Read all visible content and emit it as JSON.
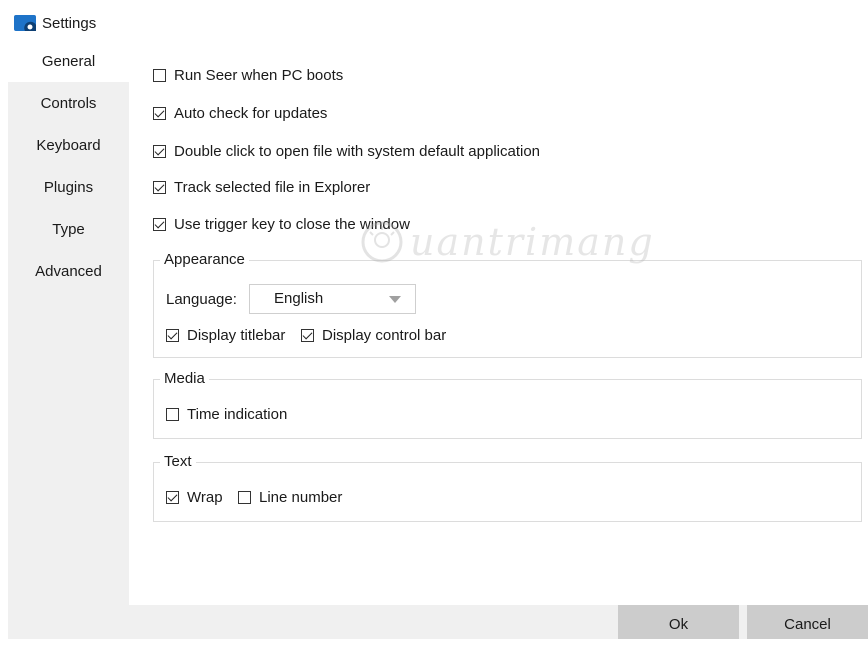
{
  "window": {
    "title": "Settings",
    "icon": "app-icon"
  },
  "sidebar": {
    "items": [
      {
        "label": "General",
        "selected": true
      },
      {
        "label": "Controls"
      },
      {
        "label": "Keyboard"
      },
      {
        "label": "Plugins"
      },
      {
        "label": "Type"
      },
      {
        "label": "Advanced"
      }
    ]
  },
  "general": {
    "options": [
      {
        "label": "Run Seer when PC boots",
        "checked": false
      },
      {
        "label": "Auto check for updates",
        "checked": true
      },
      {
        "label": "Double click to open file with system default application",
        "checked": true
      },
      {
        "label": "Track selected file in Explorer",
        "checked": true
      },
      {
        "label": "Use trigger key to close the window",
        "checked": true
      }
    ]
  },
  "appearance": {
    "title": "Appearance",
    "language_label": "Language:",
    "language_value": "English",
    "display_titlebar": {
      "label": "Display titlebar",
      "checked": true
    },
    "display_control_bar": {
      "label": "Display control bar",
      "checked": true
    }
  },
  "media": {
    "title": "Media",
    "time_indication": {
      "label": "Time indication",
      "checked": false
    }
  },
  "text": {
    "title": "Text",
    "wrap": {
      "label": "Wrap",
      "checked": true
    },
    "line_number": {
      "label": "Line number",
      "checked": false
    }
  },
  "watermark": {
    "text": "uantrimang"
  },
  "footer": {
    "ok_label": "Ok",
    "cancel_label": "Cancel"
  },
  "colors": {
    "sidebar_bg": "#f0f0f0",
    "button_bg": "#cccccc",
    "icon_blue": "#1e73c8"
  }
}
